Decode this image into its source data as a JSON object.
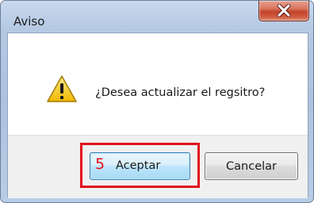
{
  "window": {
    "title": "Aviso"
  },
  "dialog": {
    "message": "¿Desea actualizar el regsitro?",
    "icon": "warning-icon"
  },
  "buttons": {
    "accept_label": "Aceptar",
    "cancel_label": "Cancelar"
  },
  "annotation": {
    "step_number": "5",
    "color": "#e3101c"
  },
  "colors": {
    "close_button": "#c3452b",
    "accept_border": "#3c7fb1",
    "warning_fill": "#f5c518"
  }
}
